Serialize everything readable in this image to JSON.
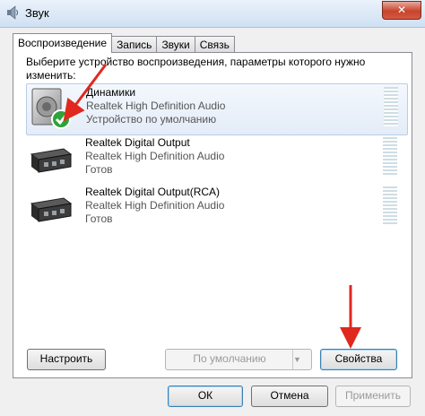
{
  "window": {
    "title": "Звук",
    "close_glyph": "✕"
  },
  "tabs": [
    {
      "label": "Воспроизведение",
      "active": true
    },
    {
      "label": "Запись",
      "active": false
    },
    {
      "label": "Звуки",
      "active": false
    },
    {
      "label": "Связь",
      "active": false
    }
  ],
  "instruction": "Выберите устройство воспроизведения, параметры которого нужно изменить:",
  "devices": [
    {
      "name": "Динамики",
      "driver": "Realtek High Definition Audio",
      "status": "Устройство по умолчанию",
      "icon": "speaker-icon",
      "selected": true
    },
    {
      "name": "Realtek Digital Output",
      "driver": "Realtek High Definition Audio",
      "status": "Готов",
      "icon": "digital-output-icon",
      "selected": false
    },
    {
      "name": "Realtek Digital Output(RCA)",
      "driver": "Realtek High Definition Audio",
      "status": "Готов",
      "icon": "digital-output-icon",
      "selected": false
    }
  ],
  "buttons": {
    "configure": "Настроить",
    "set_default": "По умолчанию",
    "properties": "Свойства",
    "ok": "ОК",
    "cancel": "Отмена",
    "apply": "Применить"
  },
  "colors": {
    "annotation_arrow": "#e0281e",
    "check_badge": "#2ea33a"
  }
}
